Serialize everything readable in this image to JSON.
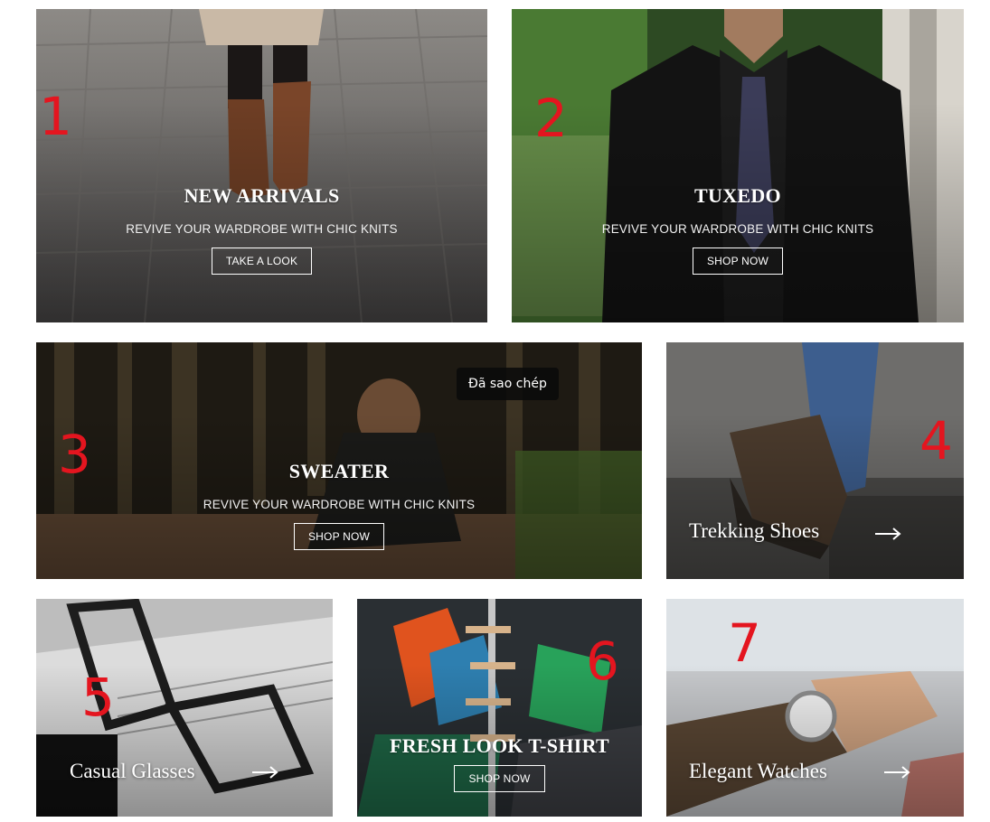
{
  "tiles": {
    "t1": {
      "number": "1",
      "title": "NEW ARRIVALS",
      "subtitle": "REVIVE YOUR WARDROBE WITH CHIC KNITS",
      "button": "TAKE A LOOK"
    },
    "t2": {
      "number": "2",
      "title": "TUXEDO",
      "subtitle": "REVIVE YOUR WARDROBE WITH CHIC KNITS",
      "button": "SHOP NOW"
    },
    "t3": {
      "number": "3",
      "title": "SWEATER",
      "subtitle": "REVIVE YOUR WARDROBE WITH CHIC KNITS",
      "button": "SHOP NOW",
      "toast": "Đã sao chép"
    },
    "t4": {
      "number": "4",
      "title": "Trekking Shoes"
    },
    "t5": {
      "number": "5",
      "title": "Casual Glasses"
    },
    "t6": {
      "number": "6",
      "title": "FRESH LOOK T-SHIRT",
      "button": "SHOP NOW"
    },
    "t7": {
      "number": "7",
      "title": "Elegant Watches"
    }
  },
  "colors": {
    "annotation": "#e4151f",
    "overlay_text": "#ffffff"
  },
  "icons": {
    "arrow": "arrow-right-icon"
  }
}
